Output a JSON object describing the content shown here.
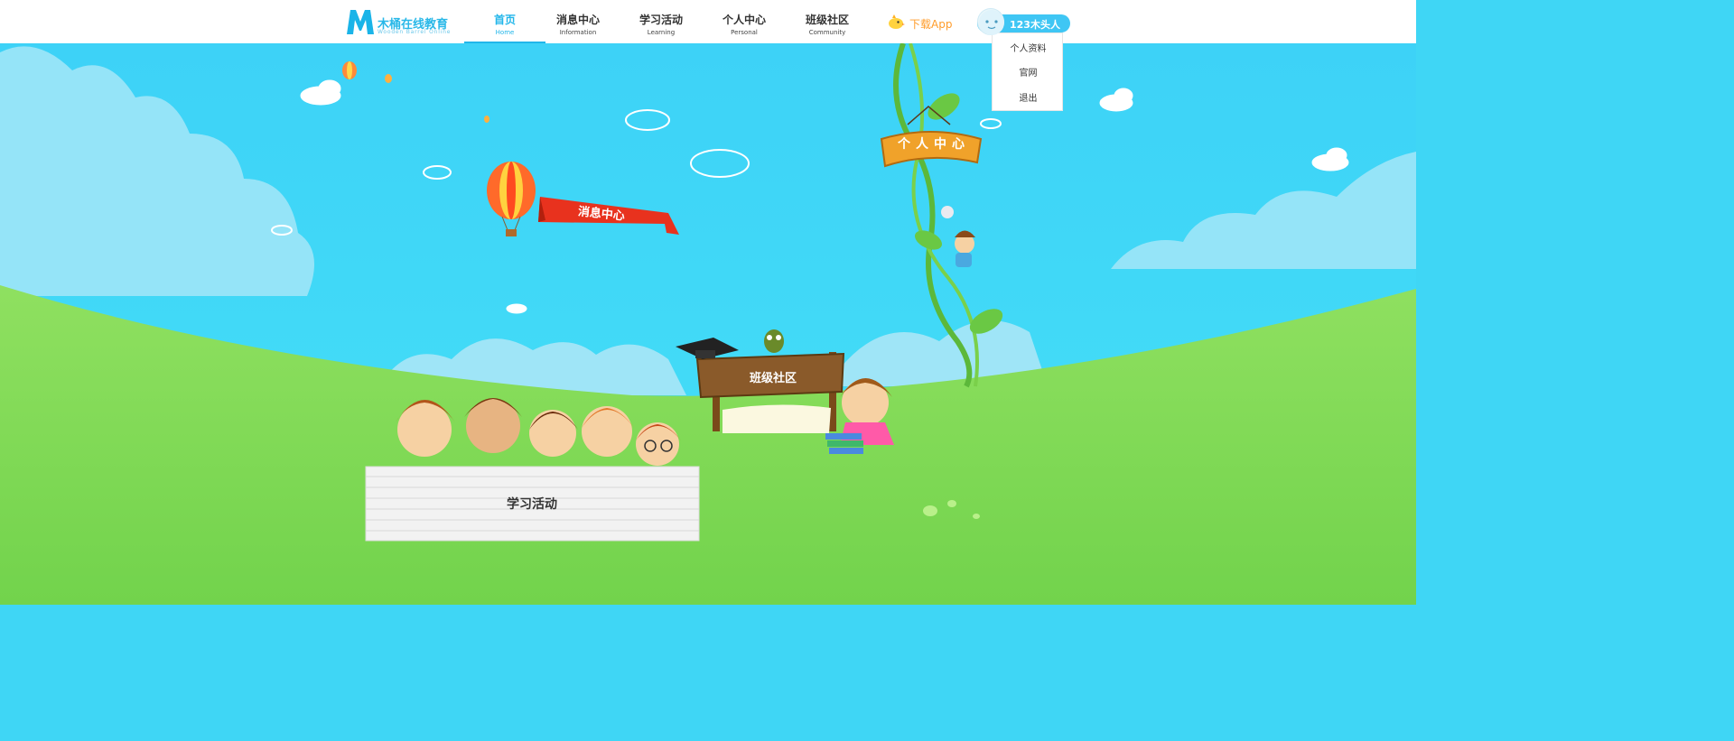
{
  "logo": {
    "name": "木桶在线教育",
    "tagline": "Wooden Barrel Online"
  },
  "nav": [
    {
      "cn": "首页",
      "en": "Home",
      "active": true
    },
    {
      "cn": "消息中心",
      "en": "Information",
      "active": false
    },
    {
      "cn": "学习活动",
      "en": "Learning",
      "active": false
    },
    {
      "cn": "个人中心",
      "en": "Personal",
      "active": false
    },
    {
      "cn": "班级社区",
      "en": "Community",
      "active": false
    }
  ],
  "download": {
    "label": "下载App",
    "icon": "bird-icon"
  },
  "user": {
    "name": "123木头人",
    "menu": [
      "个人资料",
      "官网",
      "退出"
    ]
  },
  "scene": {
    "message_banner": "消息中心",
    "personal_sign": "个人中心",
    "community_sign": "班级社区",
    "learning_board": "学习活动"
  },
  "colors": {
    "accent": "#21b6ea",
    "download": "#ff9c2a",
    "sky": "#3fd6f5",
    "grass": "#7edb55"
  }
}
